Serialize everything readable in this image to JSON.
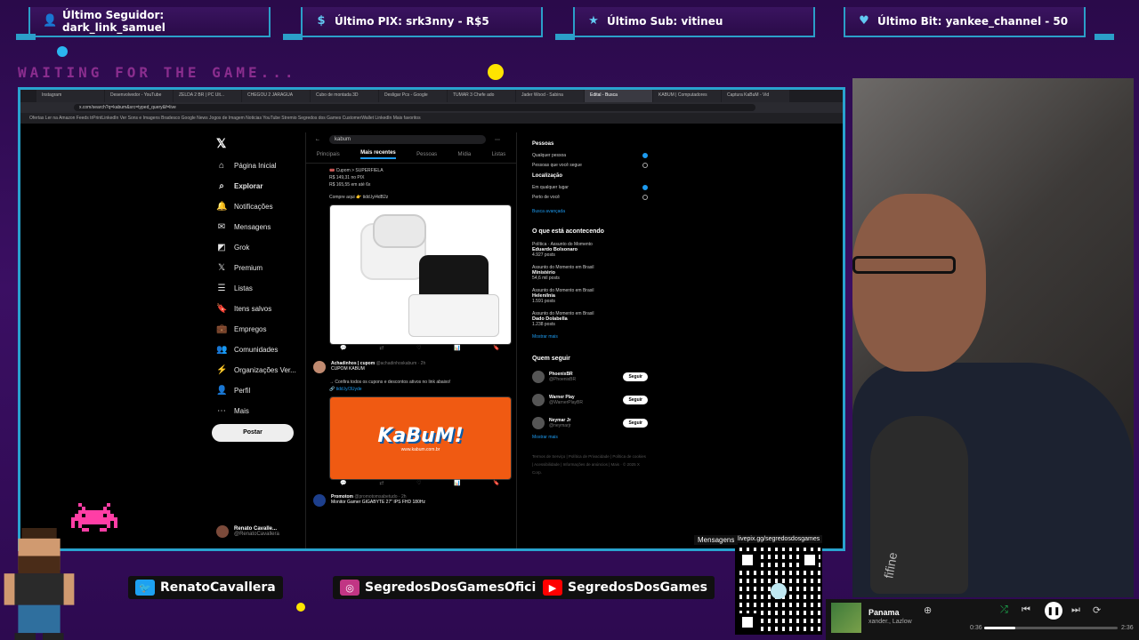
{
  "alerts": [
    {
      "icon": "user-icon",
      "label": "Último Seguidor: dark_link_samuel"
    },
    {
      "icon": "dollar-icon",
      "label": "Último PIX: srk3nny - R$5"
    },
    {
      "icon": "star-icon",
      "label": "Último Sub: vitineu"
    },
    {
      "icon": "diamond-icon",
      "label": "Último Bit: yankee_channel - 50"
    }
  ],
  "waiting_text": "WAITING FOR THE GAME...",
  "browser": {
    "tabs": [
      "Instagram",
      "Desenvolvedor - YouTube",
      "ZELDA 2 BR | PC Ult...",
      "CHEGOU 2 JARAGUA",
      "Cubo de montada 3D",
      "Desligar Pcs - Google",
      "TUMAR 3 Chefe ado",
      "Jader Wood - Sabina",
      "Edital - Busca",
      "KABUM | Computadores",
      "Captura KaBuM - Vid"
    ],
    "url": "x.com/search?q=kabum&src=typed_query&f=live",
    "bookmarks": "Ofertas   Ler na Amazon   Feeds   trPrintLinkedIn   Ver   Sons e Imagens   Bradesco   Google News   Jogos de Imagem   Noticias   YouTube   Stremio   Segredos dos Games   CustomerWallet   LinkedIn   Mais favoritos"
  },
  "twitter": {
    "nav": [
      {
        "icon": "home-icon",
        "label": "Página Inicial",
        "bold": false
      },
      {
        "icon": "search-icon",
        "label": "Explorar",
        "bold": true
      },
      {
        "icon": "bell-icon",
        "label": "Notificações",
        "bold": false
      },
      {
        "icon": "mail-icon",
        "label": "Mensagens",
        "bold": false
      },
      {
        "icon": "grok-icon",
        "label": "Grok",
        "bold": false
      },
      {
        "icon": "x-icon",
        "label": "Premium",
        "bold": false
      },
      {
        "icon": "list-icon",
        "label": "Listas",
        "bold": false
      },
      {
        "icon": "bookmark-icon",
        "label": "Itens salvos",
        "bold": false
      },
      {
        "icon": "briefcase-icon",
        "label": "Empregos",
        "bold": false
      },
      {
        "icon": "community-icon",
        "label": "Comunidades",
        "bold": false
      },
      {
        "icon": "verified-icon",
        "label": "Organizações Ver...",
        "bold": false
      },
      {
        "icon": "profile-icon",
        "label": "Perfil",
        "bold": false
      },
      {
        "icon": "more-icon",
        "label": "Mais",
        "bold": false
      }
    ],
    "post_button": "Postar",
    "user": "Renato Cavalle...",
    "user_handle": "@RenatoCavallera",
    "search_value": "kabum",
    "filter_tabs": [
      "Principais",
      "Mais recentes",
      "Pessoas",
      "Mídia",
      "Listas"
    ],
    "tweet1_lines": [
      "🎟️ Cupom > SUPERFIELA",
      "R$ 149,31 no PIX",
      "R$ 165,55 em até 6x",
      "Compre aqui 👉 tidd.ly/4dB2z"
    ],
    "tweet2": {
      "name": "Achadinhos | cupom",
      "handle": "@achadinhoskabum · 2h",
      "text": "CUPOM KABUM",
      "body": "→ Confira todos os cupons e descontos ativos no link abaixo!",
      "link": "🔗 tidd.ly/3Uyde",
      "kabum_logo": "KaBuM!",
      "kabum_url": "www.kabum.com.br"
    },
    "tweet3": {
      "name": "Promotom",
      "handle": "@promotomsabetudo · 2h",
      "text": "Monitor Gamer GIGABYTE 27\" IPS FHD 180Hz"
    },
    "right": {
      "people_title": "Pessoas",
      "people_opts": [
        "Qualquer pessoa",
        "Pessoas que você segue"
      ],
      "location_title": "Localização",
      "location_opts": [
        "Em qualquer lugar",
        "Perto de você"
      ],
      "advanced": "Busca avançada",
      "trends_title": "O que está acontecendo",
      "trends": [
        {
          "ctx": "Política · Assunto do Momento",
          "name": "Eduardo Bolsonaro",
          "count": "4.927 posts"
        },
        {
          "ctx": "Assunto do Momento em Brasil",
          "name": "Ministério",
          "count": "54,6 mil posts"
        },
        {
          "ctx": "Assunto do Momento em Brasil",
          "name": "Helenílnia",
          "count": "1.591 posts"
        },
        {
          "ctx": "Assunto do Momento em Brasil",
          "name": "Dado Dolabella",
          "count": "1.238 posts"
        }
      ],
      "show_more": "Mostrar mais",
      "follow_title": "Quem seguir",
      "follow": [
        {
          "name": "PhoenixBR",
          "handle": "@PhoenixBR"
        },
        {
          "name": "Warner Play",
          "handle": "@WarnerPlayBR"
        },
        {
          "name": "Neymar Jr",
          "handle": "@neymarjr"
        }
      ],
      "follow_button": "Seguir",
      "footer": "Termos de Serviço | Política de Privacidade | Política de cookies | Acessibilidade | Informações de anúncios | Mais · © 2025 X Corp."
    },
    "messages": "Mensagens"
  },
  "social": [
    {
      "icon": "twitter-icon",
      "label": "RenatoCavallera",
      "color": "#1da1f2"
    },
    {
      "icon": "instagram-icon",
      "label": "SegredosDosGamesOficial",
      "color": "#c13584"
    },
    {
      "icon": "youtube-icon",
      "label": "SegredosDosGames",
      "color": "#ff0000"
    }
  ],
  "qr_label": "livepix.gg/segredosdosgames",
  "player": {
    "song": "Panama",
    "artist": "xander., Lazlow",
    "elapsed": "0:36",
    "duration": "2:36",
    "progress": 0.23
  },
  "mic_brand": "fifine"
}
